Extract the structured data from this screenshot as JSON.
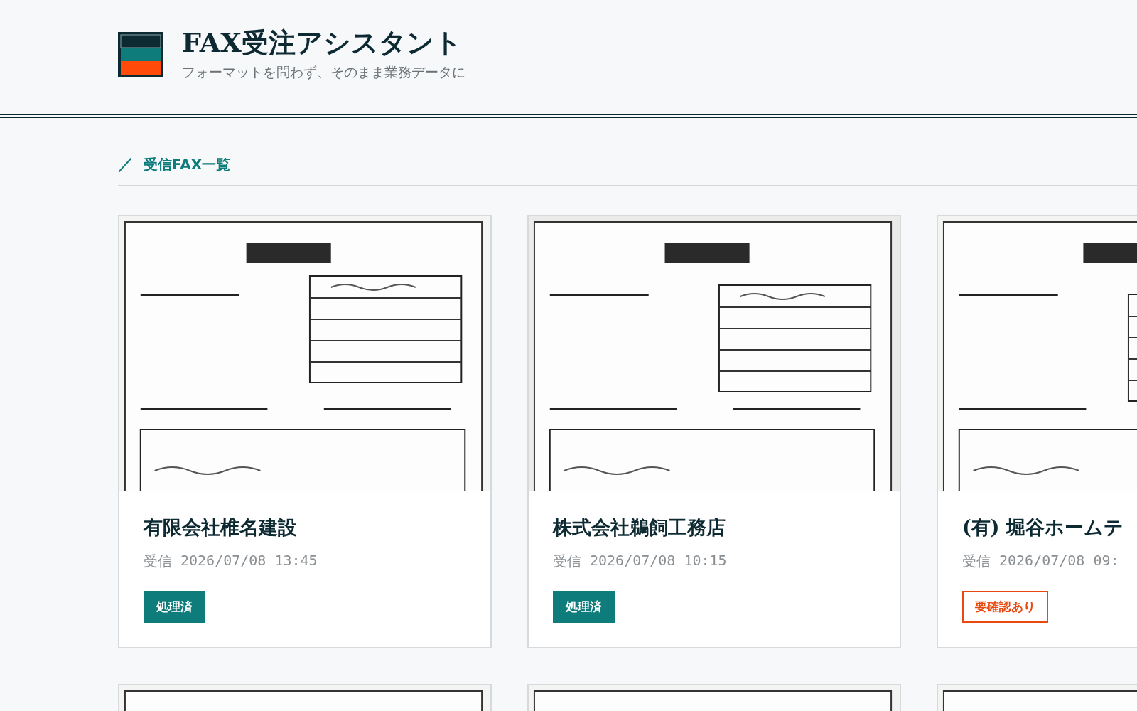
{
  "header": {
    "title": "FAX受注アシスタント",
    "subtitle": "フォーマットを問わず、そのまま業務データに"
  },
  "section": {
    "mark": "／",
    "title": "受信FAX一覧"
  },
  "faxes": [
    {
      "kind": "fax",
      "company": "有限会社椎名建設",
      "received_label": "受信",
      "received_at": "2026/07/08 13:45",
      "status": {
        "kind": "done",
        "label": "処理済"
      }
    },
    {
      "kind": "fax",
      "company": "株式会社鵜飼工務店",
      "received_label": "受信",
      "received_at": "2026/07/08 10:15",
      "status": {
        "kind": "done",
        "label": "処理済"
      }
    },
    {
      "kind": "fax",
      "company": "(有) 堀谷ホームテ",
      "received_label": "受信",
      "received_at": "2026/07/08 09:",
      "status": {
        "kind": "review",
        "label": "要確認あり"
      }
    },
    {
      "kind": "picture"
    },
    {
      "kind": "picture"
    },
    {
      "kind": "picture"
    }
  ]
}
